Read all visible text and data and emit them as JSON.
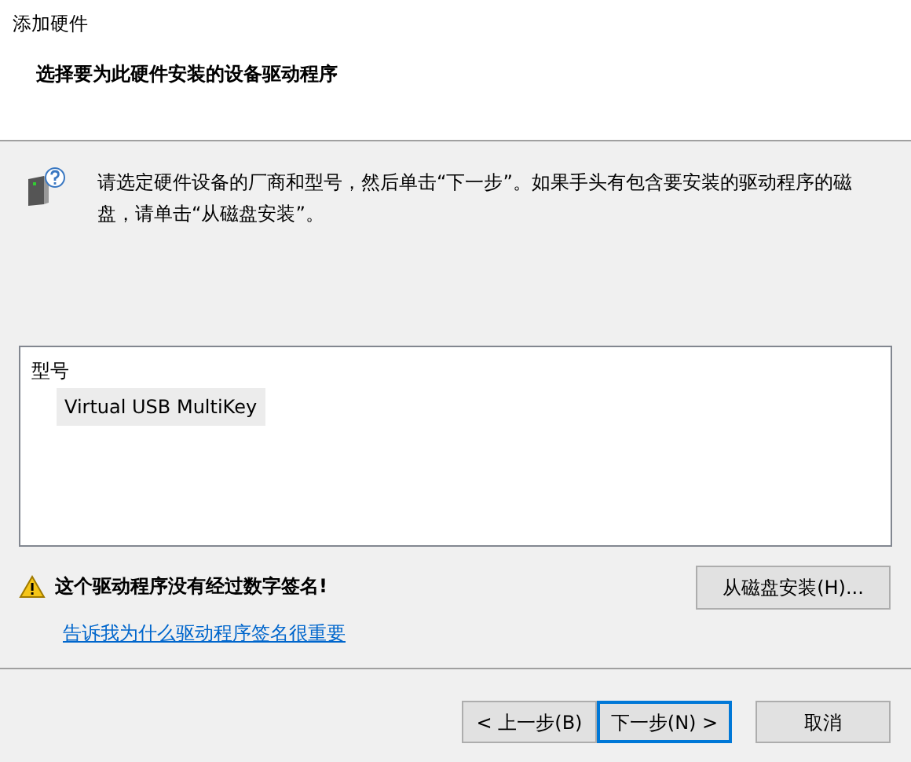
{
  "window": {
    "title": "添加硬件"
  },
  "header": {
    "heading": "选择要为此硬件安装的设备驱动程序"
  },
  "instruction": "请选定硬件设备的厂商和型号，然后单击“下一步”。如果手头有包含要安装的驱动程序的磁盘，请单击“从磁盘安装”。",
  "model_list": {
    "heading": "型号",
    "items": [
      {
        "label": "Virtual USB MultiKey",
        "selected": true
      }
    ]
  },
  "warning": {
    "text": "这个驱动程序没有经过数字签名!",
    "link": "告诉我为什么驱动程序签名很重要"
  },
  "have_disk_button": "从磁盘安装(H)...",
  "buttons": [
    {
      "label": "< 上一步(B)",
      "default": false
    },
    {
      "label": "下一步(N) >",
      "default": true
    },
    {
      "label": "取消",
      "default": false
    }
  ]
}
